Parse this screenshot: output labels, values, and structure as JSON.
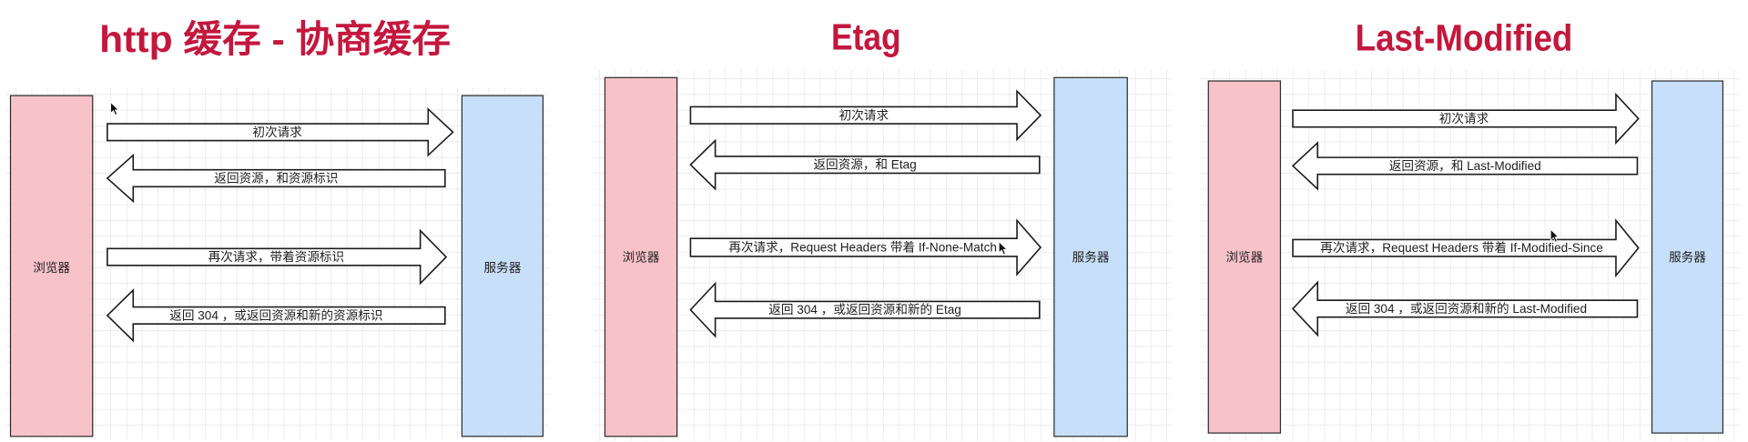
{
  "panels": [
    {
      "title": "http 缓存 - 协商缓存",
      "browser": "浏览器",
      "server": "服务器",
      "messages": [
        "初次请求",
        "返回资源，和资源标识",
        "再次请求，带着资源标识",
        "返回 304 ，或返回资源和新的资源标识"
      ]
    },
    {
      "title": "Etag",
      "browser": "浏览器",
      "server": "服务器",
      "messages": [
        "初次请求",
        "返回资源，和 Etag",
        "再次请求，Request Headers 带着 If-None-Match",
        "返回 304 ，或返回资源和新的 Etag"
      ]
    },
    {
      "title": "Last-Modified",
      "browser": "浏览器",
      "server": "服务器",
      "messages": [
        "初次请求",
        "返回资源，和 Last-Modified",
        "再次请求，Request Headers 带着 If-Modified-Since",
        "返回 304 ，或返回资源和新的 Last-Modified"
      ]
    }
  ],
  "colors": {
    "title": "#c4173d",
    "browser_box": "#f8c2c9",
    "server_box": "#c8dff9",
    "arrow": "#ffffff",
    "grid": "#e6e6e6",
    "cursor": "#111111"
  },
  "icons": {
    "cursor": "mouse-pointer-icon"
  }
}
